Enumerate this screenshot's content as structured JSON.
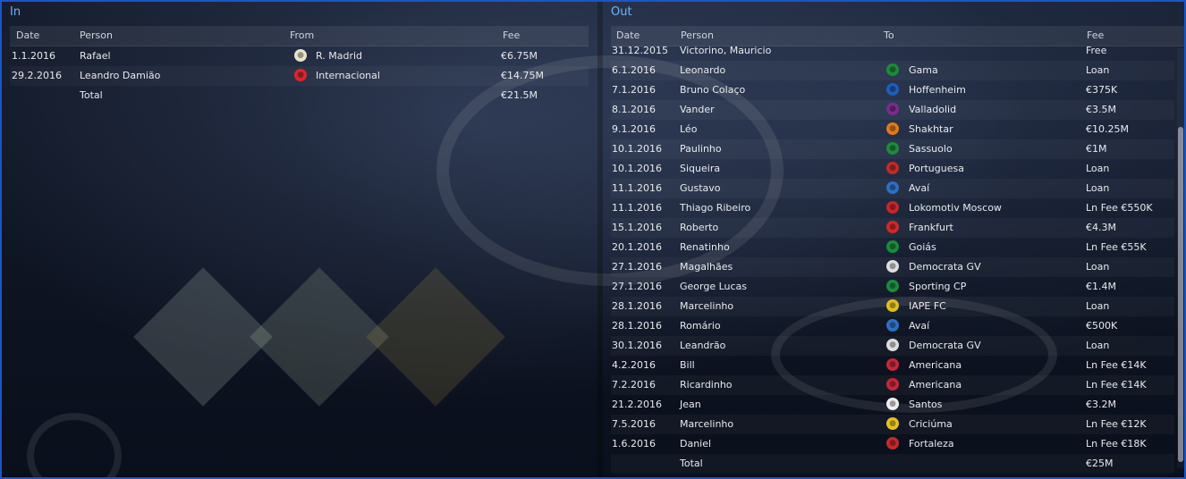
{
  "colors": {
    "title": "#6fb4ff",
    "border": "#1a56c8"
  },
  "in": {
    "title": "In",
    "headers": {
      "date": "Date",
      "person": "Person",
      "from": "From",
      "fee": "Fee"
    },
    "rows": [
      {
        "date": "1.1.2016",
        "person": "Rafael",
        "club": "R. Madrid",
        "fee": "€6.75M",
        "icon": "real-madrid-badge-icon",
        "color": "#e8e2c8"
      },
      {
        "date": "29.2.2016",
        "person": "Leandro Damião",
        "club": "Internacional",
        "fee": "€14.75M",
        "icon": "internacional-badge-icon",
        "color": "#d8262e"
      }
    ],
    "total_label": "Total",
    "total_fee": "€21.5M"
  },
  "out": {
    "title": "Out",
    "headers": {
      "date": "Date",
      "person": "Person",
      "to": "To",
      "fee": "Fee"
    },
    "rows": [
      {
        "date": "31.12.2015",
        "person": "Victorino, Mauricio",
        "club": "",
        "fee": "Free",
        "icon": "",
        "color": ""
      },
      {
        "date": "6.1.2016",
        "person": "Leonardo",
        "club": "Gama",
        "fee": "Loan",
        "icon": "gama-badge-icon",
        "color": "#1e8a3a"
      },
      {
        "date": "7.1.2016",
        "person": "Bruno Colaço",
        "club": "Hoffenheim",
        "fee": "€375K",
        "icon": "hoffenheim-badge-icon",
        "color": "#1c5fb8"
      },
      {
        "date": "8.1.2016",
        "person": "Vander",
        "club": "Valladolid",
        "fee": "€3.5M",
        "icon": "valladolid-badge-icon",
        "color": "#7a2c8e"
      },
      {
        "date": "9.1.2016",
        "person": "Léo",
        "club": "Shakhtar",
        "fee": "€10.25M",
        "icon": "shakhtar-badge-icon",
        "color": "#e07a1a"
      },
      {
        "date": "10.1.2016",
        "person": "Paulinho",
        "club": "Sassuolo",
        "fee": "€1M",
        "icon": "sassuolo-badge-icon",
        "color": "#1f8a3e"
      },
      {
        "date": "10.1.2016",
        "person": "Siqueira",
        "club": "Portuguesa",
        "fee": "Loan",
        "icon": "portuguesa-badge-icon",
        "color": "#c42a2a"
      },
      {
        "date": "11.1.2016",
        "person": "Gustavo",
        "club": "Avaí",
        "fee": "Loan",
        "icon": "avai-badge-icon",
        "color": "#2d6fc4"
      },
      {
        "date": "11.1.2016",
        "person": "Thiago Ribeiro",
        "club": "Lokomotiv Moscow",
        "fee": "Ln Fee €550K",
        "icon": "lokomotiv-badge-icon",
        "color": "#c8262a"
      },
      {
        "date": "15.1.2016",
        "person": "Roberto",
        "club": "Frankfurt",
        "fee": "€4.3M",
        "icon": "frankfurt-badge-icon",
        "color": "#d02828"
      },
      {
        "date": "20.1.2016",
        "person": "Renatinho",
        "club": "Goiás",
        "fee": "Ln Fee €55K",
        "icon": "goias-badge-icon",
        "color": "#1a8c3c"
      },
      {
        "date": "27.1.2016",
        "person": "Magalhães",
        "club": "Democrata GV",
        "fee": "Loan",
        "icon": "democrata-badge-icon",
        "color": "#dddddd"
      },
      {
        "date": "27.1.2016",
        "person": "George Lucas",
        "club": "Sporting CP",
        "fee": "€1.4M",
        "icon": "sporting-badge-icon",
        "color": "#1c8a40"
      },
      {
        "date": "28.1.2016",
        "person": "Marcelinho",
        "club": "IAPE FC",
        "fee": "Loan",
        "icon": "iape-badge-icon",
        "color": "#e2c01a"
      },
      {
        "date": "28.1.2016",
        "person": "Romário",
        "club": "Avaí",
        "fee": "€500K",
        "icon": "avai-badge-icon",
        "color": "#2d6fc4"
      },
      {
        "date": "30.1.2016",
        "person": "Leandrão",
        "club": "Democrata GV",
        "fee": "Loan",
        "icon": "democrata-badge-icon",
        "color": "#dddddd"
      },
      {
        "date": "4.2.2016",
        "person": "Bill",
        "club": "Americana",
        "fee": "Ln Fee €14K",
        "icon": "americana-badge-icon",
        "color": "#c42838"
      },
      {
        "date": "7.2.2016",
        "person": "Ricardinho",
        "club": "Americana",
        "fee": "Ln Fee €14K",
        "icon": "americana-badge-icon",
        "color": "#c42838"
      },
      {
        "date": "21.2.2016",
        "person": "Jean",
        "club": "Santos",
        "fee": "€3.2M",
        "icon": "santos-badge-icon",
        "color": "#eeeeee"
      },
      {
        "date": "7.5.2016",
        "person": "Marcelinho",
        "club": "Criciúma",
        "fee": "Ln Fee €12K",
        "icon": "criciuma-badge-icon",
        "color": "#e8c21a"
      },
      {
        "date": "1.6.2016",
        "person": "Daniel",
        "club": "Fortaleza",
        "fee": "Ln Fee €18K",
        "icon": "fortaleza-badge-icon",
        "color": "#c42a2a"
      }
    ],
    "total_label": "Total",
    "total_fee": "€25M"
  }
}
